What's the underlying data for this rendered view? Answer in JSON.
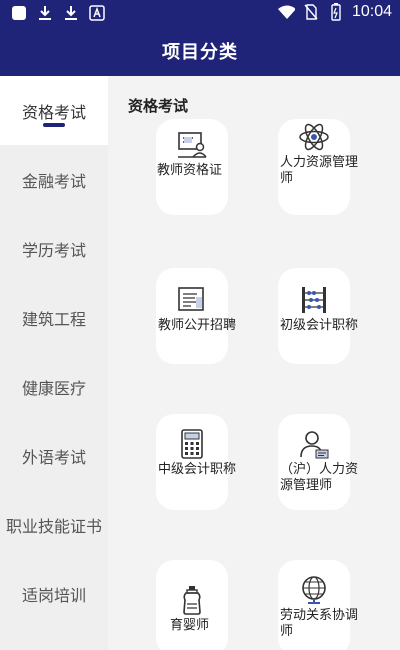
{
  "status": {
    "time": "10:04"
  },
  "header": {
    "title": "项目分类"
  },
  "sidebar": {
    "items": [
      {
        "label": "资格考试"
      },
      {
        "label": "金融考试"
      },
      {
        "label": "学历考试"
      },
      {
        "label": "建筑工程"
      },
      {
        "label": "健康医疗"
      },
      {
        "label": "外语考试"
      },
      {
        "label": "职业技能证书"
      },
      {
        "label": "适岗培训"
      }
    ],
    "active_index": 0
  },
  "main": {
    "section_title": "资格考试",
    "cards": [
      {
        "label": "教师资格证",
        "icon": "teacher-certificate-icon"
      },
      {
        "label": "人力资源管理师",
        "icon": "atom-icon"
      },
      {
        "label": "教师公开招聘",
        "icon": "recruitment-icon"
      },
      {
        "label": "初级会计职称",
        "icon": "abacus-icon"
      },
      {
        "label": "中级会计职称",
        "icon": "calculator-icon"
      },
      {
        "label": "（沪）人力资源管理师",
        "icon": "person-card-icon"
      },
      {
        "label": "育婴师",
        "icon": "baby-bottle-icon"
      },
      {
        "label": "劳动关系协调师",
        "icon": "globe-icon"
      }
    ]
  },
  "colors": {
    "brand": "#1f2478",
    "background": "#f3f3f3",
    "sidebar_bg": "#efefef"
  }
}
